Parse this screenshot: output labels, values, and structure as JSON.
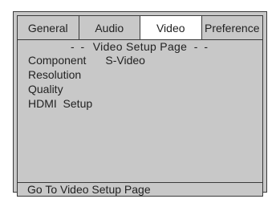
{
  "tabs": [
    {
      "label": "General"
    },
    {
      "label": "Audio"
    },
    {
      "label": "Video"
    },
    {
      "label": "Preference"
    }
  ],
  "active_tab": "Video",
  "page": {
    "title": "Video Setup Page",
    "title_dots_left": "- -",
    "title_dots_right": "- -"
  },
  "menu": {
    "items": [
      {
        "label": "Component",
        "value": "S-Video"
      },
      {
        "label": "Resolution"
      },
      {
        "label": "Quality"
      },
      {
        "label": "HDMI  Setup"
      }
    ]
  },
  "status": {
    "text": "Go To Video Setup Page"
  }
}
